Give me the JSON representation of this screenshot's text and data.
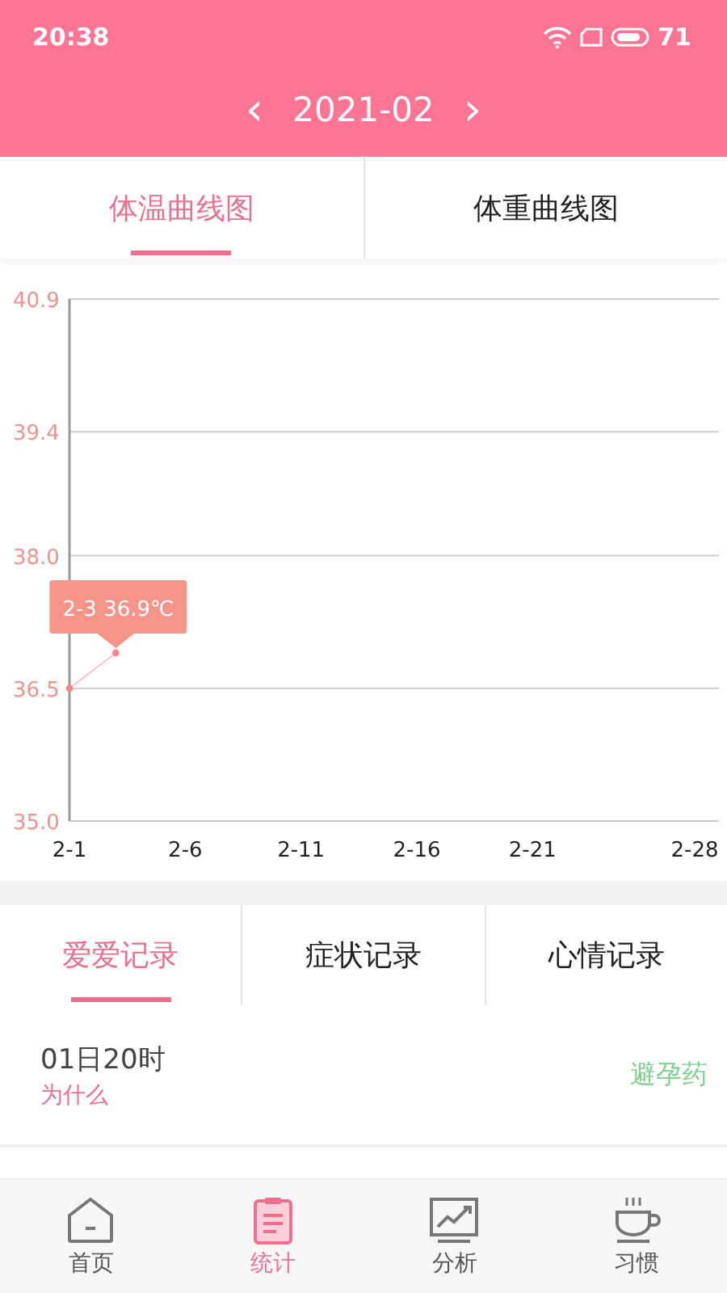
{
  "status_bar": {
    "time": "20:38",
    "battery": "71"
  },
  "header": {
    "prev": "‹",
    "title": "2021-02",
    "next": "›"
  },
  "chart_tabs": [
    {
      "label": "体温曲线图",
      "selected": true
    },
    {
      "label": "体重曲线图",
      "selected": false
    }
  ],
  "chart": {
    "tooltip": "2-3 36.9℃",
    "chart_data": {
      "type": "line",
      "categories": [
        "2-1",
        null,
        null,
        null,
        null,
        "2-6",
        null,
        null,
        null,
        null,
        "2-11",
        null,
        null,
        null,
        null,
        "2-16",
        null,
        null,
        null,
        null,
        "2-21",
        null,
        null,
        null,
        null,
        null,
        null,
        "2-28"
      ],
      "series": [
        {
          "color": "#f08a8a",
          "marker": true,
          "values": [
            36.5,
            null,
            36.9,
            null,
            null,
            null,
            null,
            null,
            null,
            null,
            null,
            null,
            null,
            null,
            null,
            null,
            null,
            null,
            null,
            null,
            null,
            null,
            null,
            null,
            null,
            null,
            null,
            null
          ]
        }
      ],
      "ylim": [
        35.0,
        40.9
      ],
      "grid": true,
      "yticks": [
        {
          "value": 35.0,
          "label": "35.0"
        },
        {
          "value": 36.5,
          "label": "36.5"
        },
        {
          "value": 38.0,
          "label": "38.0"
        },
        {
          "value": 39.4,
          "label": "39.4"
        },
        {
          "value": 40.9,
          "label": "40.9"
        }
      ]
    }
  },
  "record_tabs": [
    {
      "label": "爱爱记录",
      "selected": true
    },
    {
      "label": "症状记录",
      "selected": false
    },
    {
      "label": "心情记录",
      "selected": false
    }
  ],
  "records": [
    {
      "time": "01日20时",
      "note": "为什么",
      "tag": "避孕药"
    }
  ],
  "bottom_nav": [
    {
      "label": "首页",
      "kind": "home",
      "selected": false
    },
    {
      "label": "统计",
      "kind": "stats",
      "selected": true
    },
    {
      "label": "分析",
      "kind": "analysis",
      "selected": false
    },
    {
      "label": "习惯",
      "kind": "habit",
      "selected": false
    }
  ]
}
